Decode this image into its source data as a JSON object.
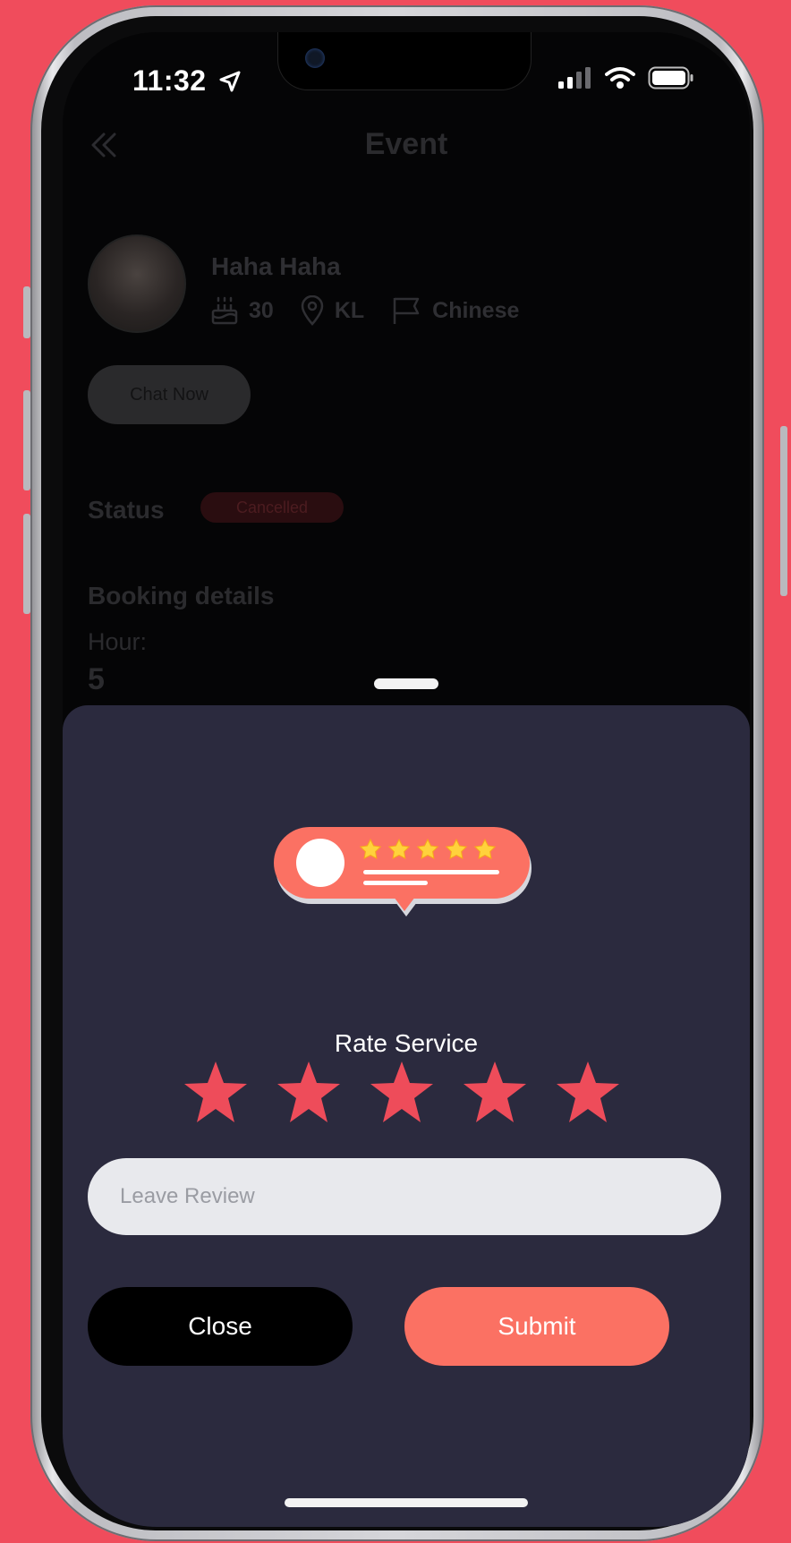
{
  "status_bar": {
    "time": "11:32"
  },
  "header": {
    "title": "Event"
  },
  "profile": {
    "name": "Haha Haha",
    "age": "30",
    "location": "KL",
    "language": "Chinese"
  },
  "chat_button": {
    "label": "Chat Now"
  },
  "status": {
    "label": "Status",
    "badge": "Cancelled"
  },
  "booking": {
    "title": "Booking details",
    "hour_label": "Hour:",
    "hour_value": "5"
  },
  "rating_sheet": {
    "title": "Rate Service",
    "star_count": 5,
    "review_placeholder": "Leave Review",
    "close_label": "Close",
    "submit_label": "Submit"
  },
  "colors": {
    "background": "#f04c5c",
    "sheet": "#2b2a3e",
    "star": "#ee4c5a",
    "submit": "#fb7163"
  }
}
